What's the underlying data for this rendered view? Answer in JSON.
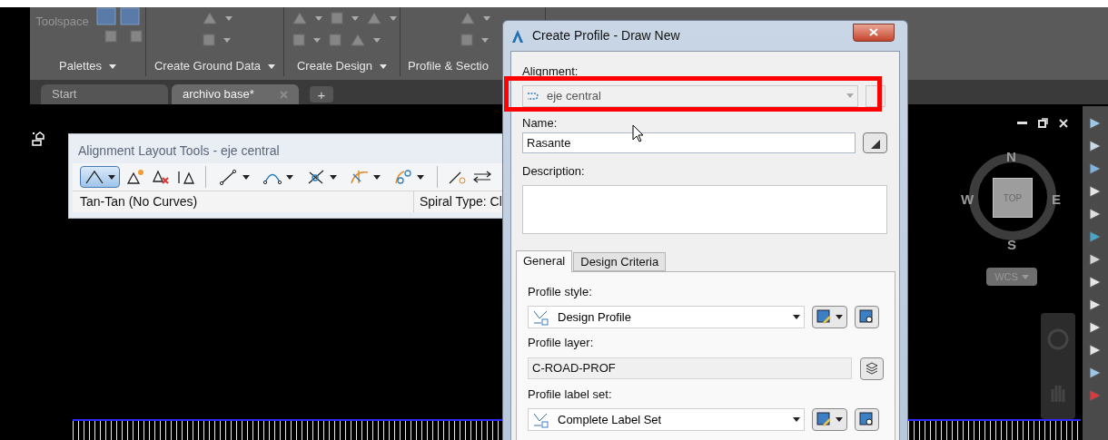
{
  "ribbon": {
    "toolspace_label": "Toolspace",
    "panels": [
      {
        "label": "Palettes",
        "menu": true
      },
      {
        "label": "Create Ground Data",
        "menu": true
      },
      {
        "label": "Create Design",
        "menu": true
      },
      {
        "label": "Profile & Sectio",
        "menu": false
      }
    ]
  },
  "file_tabs": [
    {
      "label": "Start",
      "selected": false,
      "closable": false
    },
    {
      "label": "archivo base*",
      "selected": true,
      "closable": true
    }
  ],
  "new_tab_button": "+",
  "palette": {
    "title": "Alignment Layout Tools - eje central",
    "status": "Tan-Tan (No Curves)",
    "spiral_type": "Spiral Type: Cl"
  },
  "dialog": {
    "title": "Create Profile - Draw New",
    "top_fields": [
      {
        "label": "Alignment:",
        "kind": "combo",
        "value": "eje central",
        "disabled": true
      },
      {
        "label": "Name:",
        "kind": "text",
        "value": "Rasante",
        "disabled": false
      },
      {
        "label": "Description:",
        "kind": "textarea",
        "disabled": false
      }
    ],
    "tabs": [
      {
        "label": "General",
        "selected": true
      },
      {
        "label": "Design Criteria",
        "selected": false
      }
    ],
    "general_fields": [
      {
        "label": "Profile style:",
        "kind": "style_combo",
        "value": "Design Profile"
      },
      {
        "label": "Profile layer:",
        "kind": "layer",
        "value": "C-ROAD-PROF"
      },
      {
        "label": "Profile label set:",
        "kind": "style_combo",
        "value": "Complete Label Set"
      }
    ]
  },
  "viewcube": {
    "north": "N",
    "south": "S",
    "east": "E",
    "west": "W",
    "face": "TOP",
    "ucs": "WCS"
  }
}
